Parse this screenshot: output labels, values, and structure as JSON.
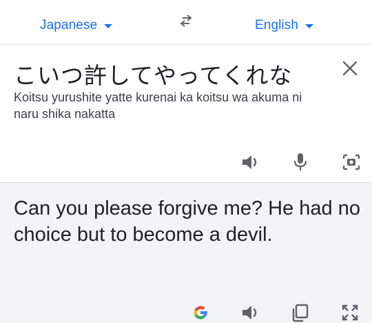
{
  "language_bar": {
    "source_language": "Japanese",
    "target_language": "English",
    "swap_icon": "swap-arrows-icon"
  },
  "source": {
    "text": "こいつ許してやってくれな",
    "romanization": "Koitsu yurushite yatte kurenai ka koitsu wa akuma ni naru shika nakatta",
    "icons": [
      "close-icon",
      "speaker-icon",
      "microphone-icon",
      "camera-icon"
    ]
  },
  "translation": {
    "text": "Can you please forgive me? He had no choice but to become a devil.",
    "icons": [
      "google-logo-icon",
      "speaker-icon",
      "copy-icon",
      "expand-icon"
    ]
  },
  "colors": {
    "accent": "#1a73e8",
    "text": "#202124",
    "icon": "#5f6368",
    "panel_background": "#f1f3f4"
  }
}
